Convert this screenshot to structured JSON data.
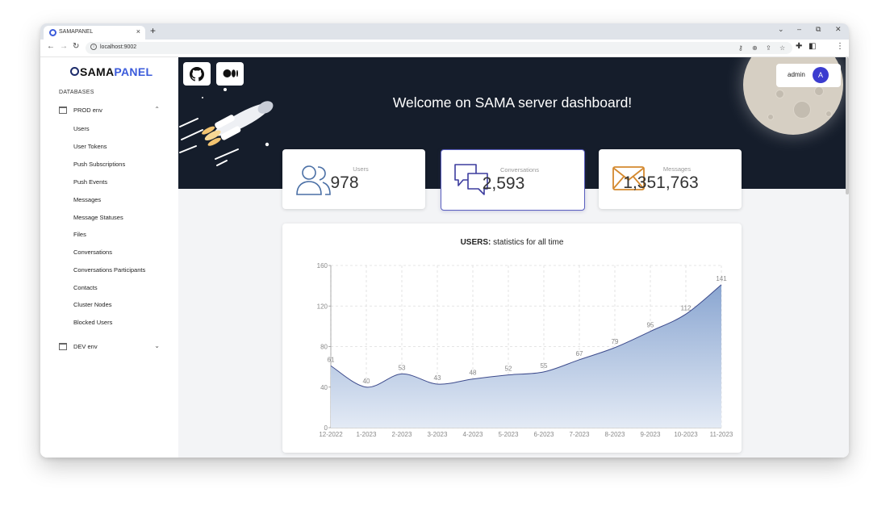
{
  "browser": {
    "tab_title": "SAMAPANEL",
    "tab_close": "×",
    "new_tab": "+",
    "url": "localhost:9002",
    "win_down": "⌄",
    "win_min": "–",
    "win_max": "⧉",
    "win_close": "✕",
    "back": "←",
    "forward": "→",
    "reload": "↻",
    "icons": [
      "key-icon",
      "zoom-icon",
      "share-icon",
      "star-icon",
      "extensions-icon",
      "sidepanel-icon",
      "menu-icon"
    ]
  },
  "sidebar": {
    "logo_prefix": "SAMA",
    "logo_suffix": "PANEL",
    "section_label": "DATABASES",
    "envs": [
      {
        "label": "PROD env",
        "expanded": true,
        "chevron": "⌃"
      },
      {
        "label": "DEV env",
        "expanded": false,
        "chevron": "⌄"
      }
    ],
    "items": [
      "Users",
      "User Tokens",
      "Push Subscriptions",
      "Push Events",
      "Messages",
      "Message Statuses",
      "Files",
      "Conversations",
      "Conversations Participants",
      "Contacts",
      "Cluster Nodes",
      "Blocked Users"
    ]
  },
  "header": {
    "welcome": "Welcome on SAMA server dashboard!",
    "user_name": "admin",
    "avatar_letter": "A",
    "buttons": [
      "github-icon",
      "medium-icon"
    ]
  },
  "stats": [
    {
      "caption": "Users",
      "value": "978",
      "icon": "users-icon",
      "color": "#4a6fa5"
    },
    {
      "caption": "Conversations",
      "value": "2,593",
      "icon": "chat-icon",
      "color": "#3c3c9e"
    },
    {
      "caption": "Messages",
      "value": "1,351,763",
      "icon": "envelope-icon",
      "color": "#d4892f"
    }
  ],
  "chart": {
    "title_bold": "USERS:",
    "title_rest": " statistics for all time"
  },
  "chart_data": {
    "type": "area",
    "categories": [
      "12-2022",
      "1-2023",
      "2-2023",
      "3-2023",
      "4-2023",
      "5-2023",
      "6-2023",
      "7-2023",
      "8-2023",
      "9-2023",
      "10-2023",
      "11-2023"
    ],
    "values": [
      61,
      40,
      53,
      43,
      48,
      52,
      55,
      67,
      79,
      95,
      112,
      141
    ],
    "ylim": [
      0,
      160
    ],
    "yticks": [
      0,
      40,
      80,
      120,
      160
    ],
    "grid": true,
    "data_labels": true,
    "fill_color_top": "#8aa6d1",
    "fill_color_bottom": "#e3eaf5",
    "line_color": "#3d4b8c"
  }
}
